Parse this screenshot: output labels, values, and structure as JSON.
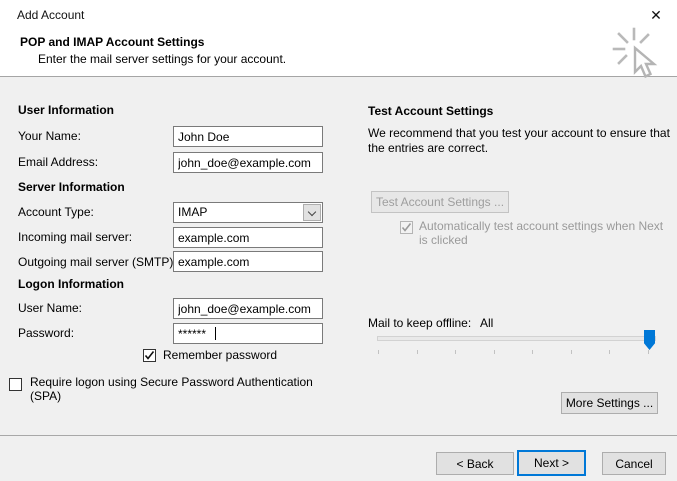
{
  "window": {
    "title": "Add Account",
    "close_glyph": "✕"
  },
  "header": {
    "title": "POP and IMAP Account Settings",
    "subtitle": "Enter the mail server settings for your account."
  },
  "user_info": {
    "title": "User Information",
    "your_name_label": "Your Name:",
    "your_name_value": "John Doe",
    "email_label": "Email Address:",
    "email_value": "john_doe@example.com"
  },
  "server_info": {
    "title": "Server Information",
    "account_type_label": "Account Type:",
    "account_type_value": "IMAP",
    "incoming_label": "Incoming mail server:",
    "incoming_value": "example.com",
    "outgoing_label": "Outgoing mail server (SMTP):",
    "outgoing_value": "example.com"
  },
  "logon_info": {
    "title": "Logon Information",
    "user_name_label": "User Name:",
    "user_name_value": "john_doe@example.com",
    "password_label": "Password:",
    "password_value": "******",
    "remember_password_label": "Remember password",
    "remember_password_checked": true,
    "spa_label": "Require logon using Secure Password Authentication (SPA)",
    "spa_checked": false
  },
  "test_settings": {
    "title": "Test Account Settings",
    "description": "We recommend that you test your account to ensure that the entries are correct.",
    "test_button_label": "Test Account Settings ...",
    "test_button_enabled": false,
    "auto_test_label": "Automatically test account settings when Next is clicked",
    "auto_test_checked": true,
    "auto_test_enabled": false
  },
  "offline": {
    "label": "Mail to keep offline:",
    "value": "All",
    "slider_position": "max"
  },
  "buttons": {
    "more_settings": "More Settings ...",
    "back": "< Back",
    "next": "Next >",
    "cancel": "Cancel"
  },
  "colors": {
    "accent": "#0078d7",
    "window_bg": "#f0f0f0",
    "header_bg": "#ffffff"
  }
}
